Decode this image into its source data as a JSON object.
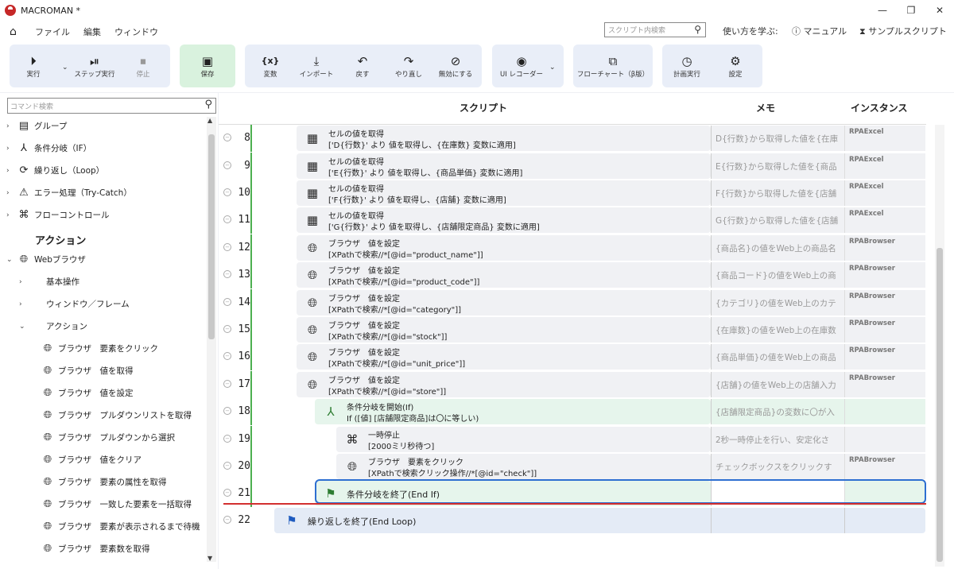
{
  "window": {
    "title": "MACROMAN *",
    "min": "—",
    "max": "❐",
    "close": "✕"
  },
  "menu": {
    "items": [
      "ファイル",
      "編集",
      "ウィンドウ"
    ],
    "search_placeholder": "スクリプト内検索",
    "learn": "使い方を学ぶ:",
    "manual": "マニュアル",
    "sample": "サンプルスクリプト"
  },
  "ribbon": {
    "run": "実行",
    "step": "ステップ実行",
    "stop": "停止",
    "save": "保存",
    "var": "変数",
    "import": "インポート",
    "undo": "戻す",
    "redo": "やり直し",
    "disable": "無効にする",
    "recorder": "UI レコーダー",
    "flowchart": "フローチャート（β版）",
    "schedule": "計画実行",
    "settings": "設定"
  },
  "sidebar": {
    "search_placeholder": "コマンド検索",
    "groups": [
      "グループ",
      "条件分岐（IF）",
      "繰り返し（Loop）",
      "エラー処理（Try-Catch）",
      "フローコントロール"
    ],
    "action_header": "アクション",
    "web": "Webブラウザ",
    "sub": [
      "基本操作",
      "ウィンドウ／フレーム",
      "アクション"
    ],
    "actions": [
      "ブラウザ　要素をクリック",
      "ブラウザ　値を取得",
      "ブラウザ　値を設定",
      "ブラウザ　プルダウンリストを取得",
      "ブラウザ　プルダウンから選択",
      "ブラウザ　値をクリア",
      "ブラウザ　要素の属性を取得",
      "ブラウザ　一致した要素を一括取得",
      "ブラウザ　要素が表示されるまで待機",
      "ブラウザ　要素数を取得"
    ]
  },
  "columns": {
    "script": "スクリプト",
    "memo": "メモ",
    "instance": "インスタンス"
  },
  "rows": [
    {
      "num": "8",
      "l1": "セルの値を取得",
      "l2": "['D{行数}' より 値を取得し、{在庫数} 変数に適用]",
      "memo": "D{行数}から取得した値を{在庫",
      "inst": "RPAExcel"
    },
    {
      "num": "9",
      "l1": "セルの値を取得",
      "l2": "['E{行数}' より 値を取得し、{商品単価} 変数に適用]",
      "memo": "E{行数}から取得した値を{商品",
      "inst": "RPAExcel"
    },
    {
      "num": "10",
      "l1": "セルの値を取得",
      "l2": "['F{行数}' より 値を取得し、{店舗} 変数に適用]",
      "memo": "F{行数}から取得した値を{店舗",
      "inst": "RPAExcel"
    },
    {
      "num": "11",
      "l1": "セルの値を取得",
      "l2": "['G{行数}' より 値を取得し、{店舗限定商品} 変数に適用]",
      "memo": "G{行数}から取得した値を{店舗",
      "inst": "RPAExcel"
    },
    {
      "num": "12",
      "l1": "ブラウザ　値を設定",
      "l2": "[XPathで検索//*[@id=\"product_name\"]]",
      "memo": "{商品名}の値をWeb上の商品名",
      "inst": "RPABrowser"
    },
    {
      "num": "13",
      "l1": "ブラウザ　値を設定",
      "l2": "[XPathで検索//*[@id=\"product_code\"]]",
      "memo": "{商品コード}の値をWeb上の商",
      "inst": "RPABrowser"
    },
    {
      "num": "14",
      "l1": "ブラウザ　値を設定",
      "l2": "[XPathで検索//*[@id=\"category\"]]",
      "memo": "{カテゴリ}の値をWeb上のカテ",
      "inst": "RPABrowser"
    },
    {
      "num": "15",
      "l1": "ブラウザ　値を設定",
      "l2": "[XPathで検索//*[@id=\"stock\"]]",
      "memo": "{在庫数}の値をWeb上の在庫数",
      "inst": "RPABrowser"
    },
    {
      "num": "16",
      "l1": "ブラウザ　値を設定",
      "l2": "[XPathで検索//*[@id=\"unit_price\"]]",
      "memo": "{商品単価}の値をWeb上の商品",
      "inst": "RPABrowser"
    },
    {
      "num": "17",
      "l1": "ブラウザ　値を設定",
      "l2": "[XPathで検索//*[@id=\"store\"]]",
      "memo": "{店舗}の値をWeb上の店舗入力",
      "inst": "RPABrowser"
    },
    {
      "num": "18",
      "l1": "条件分岐を開始(If)",
      "l2": "If ([値] [店舗限定商品]は〇に等しい)",
      "memo": "{店舗限定商品}の変数に〇が入",
      "inst": ""
    },
    {
      "num": "19",
      "l1": "一時停止",
      "l2": "[2000ミリ秒待つ]",
      "memo": "2秒一時停止を行い、安定化さ",
      "inst": ""
    },
    {
      "num": "20",
      "l1": "ブラウザ　要素をクリック",
      "l2": "[XPathで検索クリック操作//*[@id=\"check\"]]",
      "memo": "チェックボックスをクリックす",
      "inst": "RPABrowser"
    },
    {
      "num": "21",
      "l1": "条件分岐を終了(End If)",
      "memo": "",
      "inst": ""
    },
    {
      "num": "22",
      "l1": "繰り返しを終了(End Loop)",
      "memo": "",
      "inst": ""
    }
  ]
}
